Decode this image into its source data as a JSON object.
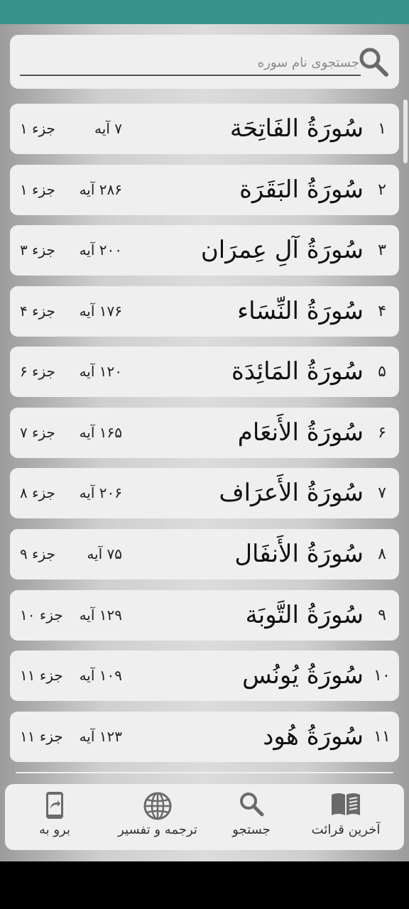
{
  "search": {
    "placeholder": "جستجوی نام سوره",
    "value": ""
  },
  "surahs": [
    {
      "num": "۱",
      "name": "سُورَةُ الفَاتِحَة",
      "ayat": "۷ آیه",
      "juz": "جزء ۱"
    },
    {
      "num": "۲",
      "name": "سُورَةُ البَقَرَة",
      "ayat": "۲۸۶ آیه",
      "juz": "جزء ۱"
    },
    {
      "num": "۳",
      "name": "سُورَةُ آلِ عِمرَان",
      "ayat": "۲۰۰ آیه",
      "juz": "جزء ۳"
    },
    {
      "num": "۴",
      "name": "سُورَةُ النِّسَاء",
      "ayat": "۱۷۶ آیه",
      "juz": "جزء ۴"
    },
    {
      "num": "۵",
      "name": "سُورَةُ المَائِدَة",
      "ayat": "۱۲۰ آیه",
      "juz": "جزء ۶"
    },
    {
      "num": "۶",
      "name": "سُورَةُ الأَنعَام",
      "ayat": "۱۶۵ آیه",
      "juz": "جزء ۷"
    },
    {
      "num": "۷",
      "name": "سُورَةُ الأَعرَاف",
      "ayat": "۲۰۶ آیه",
      "juz": "جزء ۸"
    },
    {
      "num": "۸",
      "name": "سُورَةُ الأَنفَال",
      "ayat": "۷۵ آیه",
      "juz": "جزء ۹"
    },
    {
      "num": "۹",
      "name": "سُورَةُ التَّوبَة",
      "ayat": "۱۲۹ آیه",
      "juz": "جزء ۱۰"
    },
    {
      "num": "۱۰",
      "name": "سُورَةُ يُونُس",
      "ayat": "۱۰۹ آیه",
      "juz": "جزء ۱۱"
    },
    {
      "num": "۱۱",
      "name": "سُورَةُ هُود",
      "ayat": "۱۲۳ آیه",
      "juz": "جزء ۱۱"
    }
  ],
  "nav": {
    "last_read": {
      "label": "آخرین قرائت",
      "icon": "book-icon"
    },
    "search": {
      "label": "جستجو",
      "icon": "search-icon"
    },
    "translation": {
      "label": "ترجمه و تفسیر",
      "icon": "globe-icon"
    },
    "goto": {
      "label": "برو به",
      "icon": "phone-goto-icon"
    }
  },
  "colors": {
    "status_bar": "#36938d",
    "card": "#efefef",
    "icon": "#6a6a6a"
  }
}
